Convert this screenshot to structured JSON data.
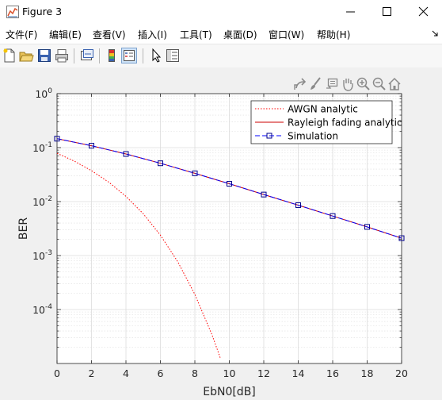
{
  "window": {
    "title": "Figure 3",
    "icon": "matlab-figure-icon"
  },
  "window_controls": [
    "minimize-icon",
    "maximize-icon",
    "close-icon"
  ],
  "menu": [
    {
      "label": "文件(F)"
    },
    {
      "label": "编辑(E)"
    },
    {
      "label": "查看(V)"
    },
    {
      "label": "插入(I)"
    },
    {
      "label": "工具(T)"
    },
    {
      "label": "桌面(D)"
    },
    {
      "label": "窗口(W)"
    },
    {
      "label": "帮助(H)"
    }
  ],
  "toolbar": [
    "new-figure-icon",
    "open-file-icon",
    "save-icon",
    "print-icon",
    "link-plot-icon",
    "insert-colorbar-icon",
    "insert-legend-icon",
    "edit-plot-icon",
    "property-inspector-icon"
  ],
  "axes_toolbar": [
    "export-icon",
    "brush-icon",
    "datatip-icon",
    "pan-icon",
    "zoom-in-icon",
    "zoom-out-icon",
    "home-icon"
  ],
  "chart_data": {
    "type": "line",
    "xlabel": "EbN0[dB]",
    "ylabel": "BER",
    "xlim": [
      0,
      20
    ],
    "ylim": [
      1e-05,
      1
    ],
    "yscale": "log",
    "xticks": [
      "0",
      "2",
      "4",
      "6",
      "8",
      "10",
      "12",
      "14",
      "16",
      "18",
      "20"
    ],
    "yticks": [
      {
        "base": "10",
        "exp": "0",
        "value": 1
      },
      {
        "base": "10",
        "exp": "-1",
        "value": 0.1
      },
      {
        "base": "10",
        "exp": "-2",
        "value": 0.01
      },
      {
        "base": "10",
        "exp": "-3",
        "value": 0.001
      },
      {
        "base": "10",
        "exp": "-4",
        "value": 0.0001
      }
    ],
    "grid": true,
    "legend_position": "top-right",
    "series": [
      {
        "name": "AWGN analytic",
        "color": "#ff0000",
        "style": "dotted",
        "x": [
          0,
          1,
          2,
          3,
          4,
          5,
          6,
          7,
          8,
          9,
          9.5
        ],
        "y": [
          0.0786,
          0.0563,
          0.0375,
          0.0229,
          0.0125,
          0.00595,
          0.00239,
          0.000773,
          0.000191,
          3.36e-05,
          1.21e-05
        ]
      },
      {
        "name": "Rayleigh fading analytic",
        "color": "#cc0000",
        "style": "solid",
        "x": [
          0,
          2,
          4,
          6,
          8,
          10,
          12,
          14,
          16,
          18,
          20
        ],
        "y": [
          0.1464,
          0.1085,
          0.0763,
          0.0513,
          0.0334,
          0.0214,
          0.0135,
          0.0086,
          0.0054,
          0.0034,
          0.0021
        ]
      },
      {
        "name": "Simulation",
        "color": "#0000ff",
        "style": "dashed",
        "marker": "square",
        "x": [
          0,
          2,
          4,
          6,
          8,
          10,
          12,
          14,
          16,
          18,
          20
        ],
        "y": [
          0.1464,
          0.1085,
          0.0763,
          0.0513,
          0.0334,
          0.0214,
          0.0135,
          0.0086,
          0.0054,
          0.0034,
          0.0021
        ]
      }
    ]
  }
}
